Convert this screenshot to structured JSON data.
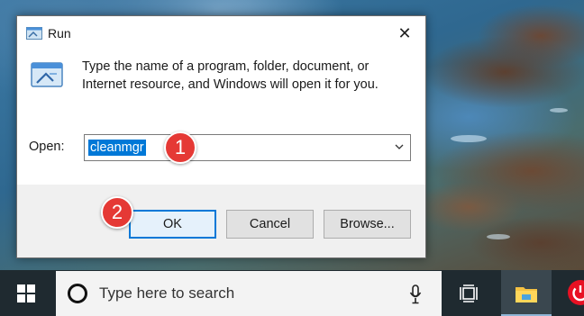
{
  "dialog": {
    "title": "Run",
    "close_glyph": "✕",
    "description": "Type the name of a program, folder, document, or Internet resource, and Windows will open it for you.",
    "open_label": "Open:",
    "open_value": "cleanmgr",
    "buttons": {
      "ok": "OK",
      "cancel": "Cancel",
      "browse": "Browse..."
    }
  },
  "callouts": {
    "one": "1",
    "two": "2"
  },
  "taskbar": {
    "search_placeholder": "Type here to search",
    "icons": [
      "windows-start-icon",
      "cortana-icon",
      "microphone-icon",
      "task-view-icon",
      "file-explorer-icon",
      "power-app-icon"
    ]
  },
  "colors": {
    "accent": "#0078d7",
    "callout": "#e53935",
    "taskbar": "#1f2a30"
  }
}
